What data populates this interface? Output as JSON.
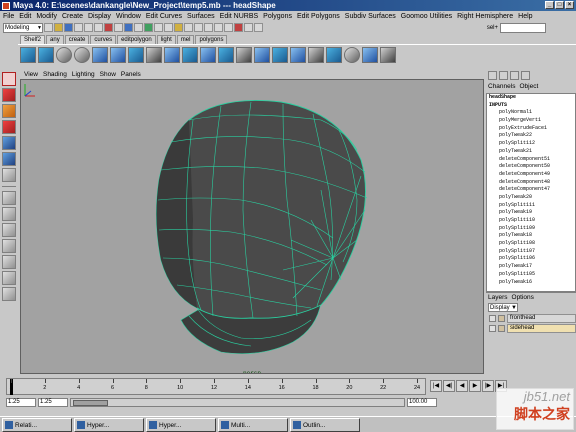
{
  "window": {
    "title": "Maya 4.0: E:\\scenes\\dankangle\\New_Project\\temp5.mb  ---  headShape"
  },
  "menubar": [
    "File",
    "Edit",
    "Modify",
    "Create",
    "Display",
    "Window",
    "Edit Curves",
    "Surfaces",
    "Edit NURBS",
    "Polygons",
    "Edit Polygons",
    "Subdiv Surfaces",
    "Goomoo Utilities",
    "Right Hemisphere",
    "Help"
  ],
  "statusline": {
    "mode": "Modeling",
    "sel_label": "sel+"
  },
  "shelf": {
    "tabs": [
      "Shelf2",
      "any",
      "create",
      "curves",
      "editpolygon",
      "light",
      "mel",
      "polygons"
    ],
    "active_tab": "Shelf2"
  },
  "panel": {
    "menu": [
      "View",
      "Shading",
      "Lighting",
      "Show",
      "Panels"
    ],
    "camera": "persp"
  },
  "channelbox": {
    "menu": [
      "Channels",
      "Object"
    ],
    "node": "headShape",
    "inputs_label": "INPUTS",
    "inputs": [
      "polyNormal1",
      "polyMergeVert1",
      "polyExtrudeFace1",
      "polyTweak22",
      "polySplit112",
      "polyTweak21",
      "deleteComponent51",
      "deleteComponent50",
      "deleteComponent49",
      "deleteComponent48",
      "deleteComponent47",
      "polyTweak20",
      "polySplit111",
      "polyTweak19",
      "polySplit110",
      "polySplit109",
      "polyTweak18",
      "polySplit108",
      "polySplit107",
      "polySplit106",
      "polyTweak17",
      "polySplit105",
      "polyTweak16"
    ]
  },
  "layers": {
    "menu": [
      "Layers",
      "Options"
    ],
    "display": "Display",
    "items": [
      "fronthead",
      "sidehead"
    ]
  },
  "timeline": {
    "ticks": [
      "1",
      "2",
      "4",
      "6",
      "8",
      "10",
      "12",
      "14",
      "16",
      "18",
      "20",
      "22",
      "24"
    ],
    "range_start": "1.25",
    "range_inner_start": "1.25",
    "range_end": "100.00"
  },
  "taskbar": [
    "Relati...",
    "Hyper...",
    "Hyper...",
    "Multi...",
    "Outlin..."
  ],
  "watermark": {
    "line1": "jb51.net",
    "line2": "脚本之家"
  }
}
